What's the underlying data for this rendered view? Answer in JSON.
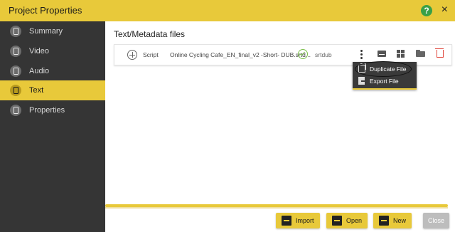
{
  "window": {
    "title": "Project Properties"
  },
  "sidebar": {
    "items": [
      {
        "label": "Summary",
        "icon": "document-icon",
        "active": false
      },
      {
        "label": "Video",
        "icon": "video-icon",
        "active": false
      },
      {
        "label": "Audio",
        "icon": "audio-icon",
        "active": false
      },
      {
        "label": "Text",
        "icon": "text-icon",
        "active": true
      },
      {
        "label": "Properties",
        "icon": "properties-icon",
        "active": false
      }
    ]
  },
  "main": {
    "heading": "Text/Metadata files",
    "file_row": {
      "type_label": "Script",
      "file_name": "Online Cycling Cafe_EN_final_v2 -Short- DUB.srtd...",
      "format": "srtdub"
    },
    "context_menu": {
      "items": [
        {
          "label": "Duplicate File",
          "icon": "duplicate-icon"
        },
        {
          "label": "Export File",
          "icon": "export-icon"
        }
      ]
    }
  },
  "footer": {
    "buttons": {
      "import": "Import",
      "open": "Open",
      "new": "New",
      "close": "Close"
    }
  },
  "colors": {
    "accent": "#e8c93a",
    "sidebar_bg": "#353535",
    "content_bg": "#ffffff",
    "success": "#7bbf4a",
    "danger": "#e0463c"
  }
}
